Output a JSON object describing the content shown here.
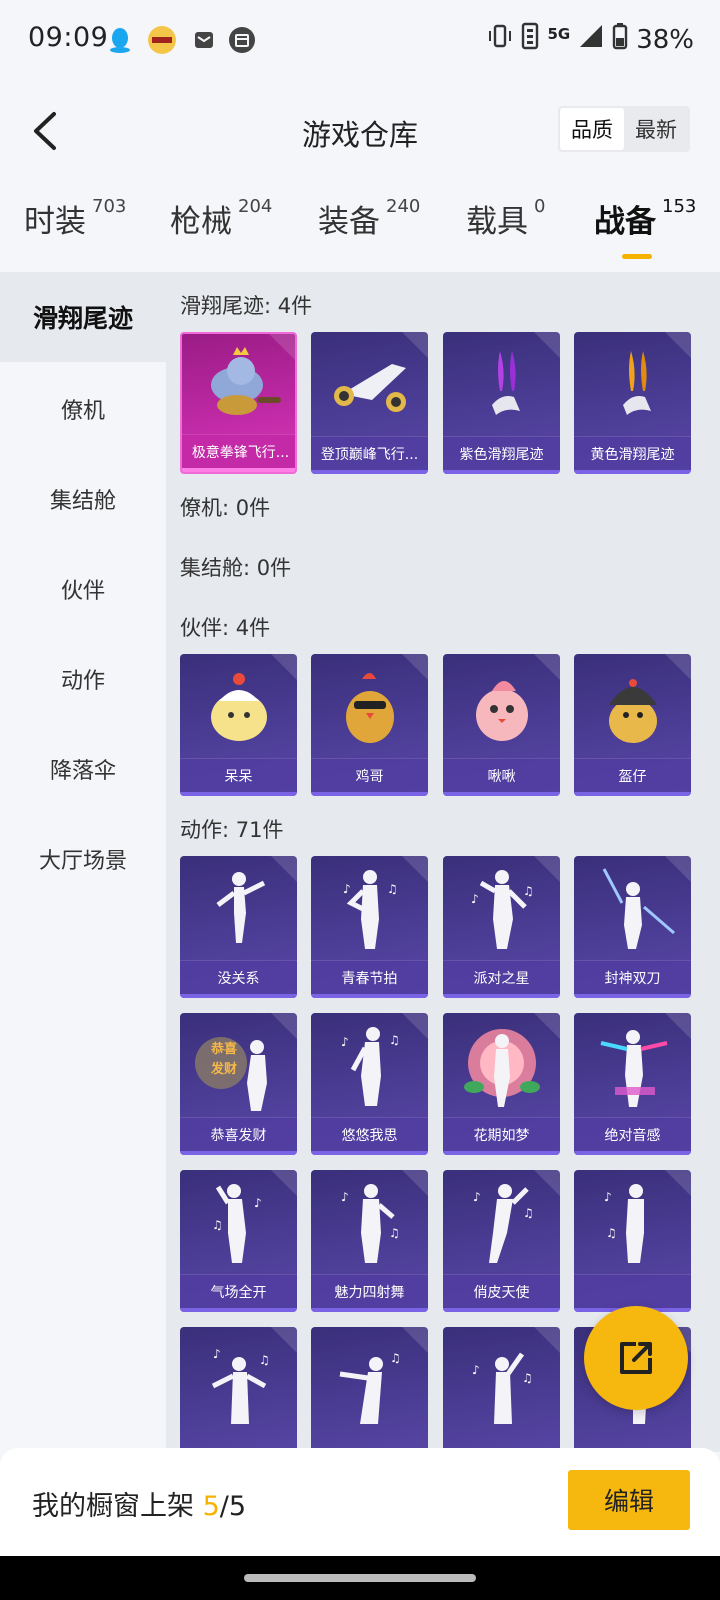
{
  "status_bar": {
    "time": "09:09",
    "network": "5G",
    "battery": "38%"
  },
  "header": {
    "title": "游戏仓库",
    "sort_options": [
      "品质",
      "最新"
    ],
    "active_sort": "品质"
  },
  "main_tabs": [
    {
      "label": "时装",
      "count": "703"
    },
    {
      "label": "枪械",
      "count": "204"
    },
    {
      "label": "装备",
      "count": "240"
    },
    {
      "label": "载具",
      "count": "0"
    },
    {
      "label": "战备",
      "count": "153",
      "active": true
    }
  ],
  "sidebar": [
    {
      "label": "滑翔尾迹",
      "active": true
    },
    {
      "label": "僚机"
    },
    {
      "label": "集结舱"
    },
    {
      "label": "伙伴"
    },
    {
      "label": "动作"
    },
    {
      "label": "降落伞"
    },
    {
      "label": "大厅场景"
    }
  ],
  "sections": {
    "glide": {
      "title": "滑翔尾迹: 4件",
      "items": [
        "极意拳锋飞行...",
        "登顶巅峰飞行...",
        "紫色滑翔尾迹",
        "黄色滑翔尾迹"
      ]
    },
    "wingman": {
      "title": "僚机: 0件"
    },
    "pod": {
      "title": "集结舱: 0件"
    },
    "partner": {
      "title": "伙伴: 4件",
      "items": [
        "呆呆",
        "鸡哥",
        "啾啾",
        "盔仔"
      ]
    },
    "action": {
      "title": "动作: 71件",
      "items": [
        "没关系",
        "青春节拍",
        "派对之星",
        "封神双刀",
        "恭喜发财",
        "悠悠我思",
        "花期如梦",
        "绝对音感",
        "气场全开",
        "魅力四射舞",
        "俏皮天使",
        ""
      ]
    }
  },
  "bottom": {
    "shelf_label": "我的橱窗上架 ",
    "shelf_current": "5",
    "shelf_total": "/5",
    "edit_label": "编辑"
  },
  "colors": {
    "accent": "#f6b80e",
    "card_purple": "#4b3d95",
    "card_pink": "#c12aa6"
  }
}
